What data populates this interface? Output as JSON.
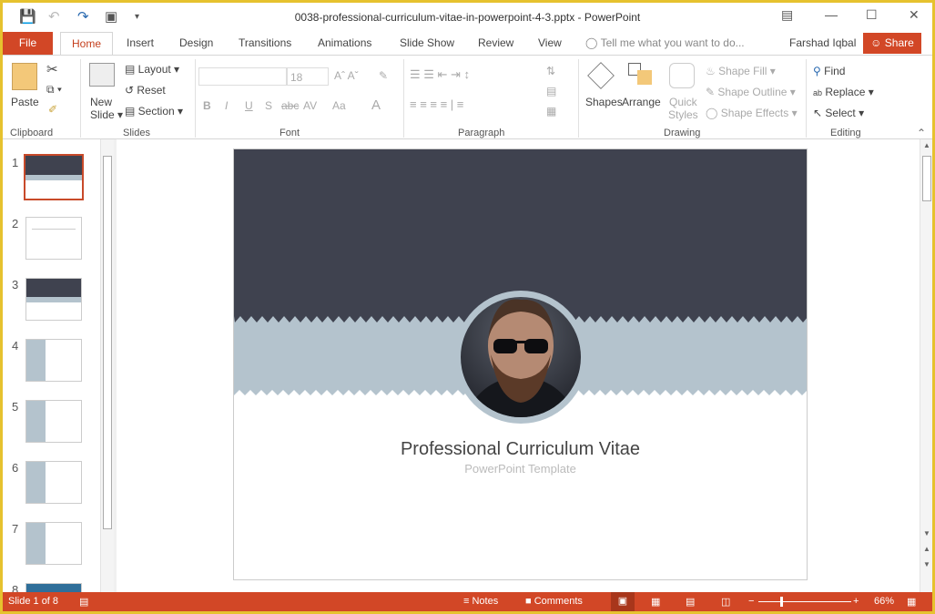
{
  "window": {
    "title": "0038-professional-curriculum-vitae-in-powerpoint-4-3.pptx - PowerPoint"
  },
  "tabs": [
    "File",
    "Home",
    "Insert",
    "Design",
    "Transitions",
    "Animations",
    "Slide Show",
    "Review",
    "View"
  ],
  "tell_me": "Tell me what you want to do...",
  "user": "Farshad Iqbal",
  "share": "Share",
  "ribbon": {
    "clipboard": {
      "paste": "Paste",
      "label": "Clipboard"
    },
    "slides": {
      "new": "New",
      "slide": "Slide",
      "layout": "Layout",
      "reset": "Reset",
      "section": "Section",
      "label": "Slides"
    },
    "font": {
      "size": "18",
      "bold": "B",
      "italic": "I",
      "underline": "U",
      "shadow": "S",
      "strike": "abc",
      "spacing": "AV",
      "case": "Aa",
      "color": "A",
      "label": "Font"
    },
    "paragraph": {
      "label": "Paragraph"
    },
    "drawing": {
      "shapes": "Shapes",
      "arrange": "Arrange",
      "quick1": "Quick",
      "quick2": "Styles",
      "fill": "Shape Fill",
      "outline": "Shape Outline",
      "effects": "Shape Effects",
      "label": "Drawing"
    },
    "editing": {
      "find": "Find",
      "replace": "Replace",
      "select": "Select",
      "label": "Editing"
    }
  },
  "thumbnails": [
    "1",
    "2",
    "3",
    "4",
    "5",
    "6",
    "7",
    "8"
  ],
  "selected_slide": 1,
  "slide": {
    "title": "Professional Curriculum Vitae",
    "subtitle": "PowerPoint Template",
    "colors": {
      "dark": "#3f424f",
      "band": "#b4c3cd"
    }
  },
  "status": {
    "slide": "Slide 1 of 8",
    "notes": "Notes",
    "comments": "Comments",
    "zoom": "66%",
    "zoom_percent": 66
  },
  "colors": {
    "accent": "#d24726",
    "frame": "#e6c22e"
  }
}
